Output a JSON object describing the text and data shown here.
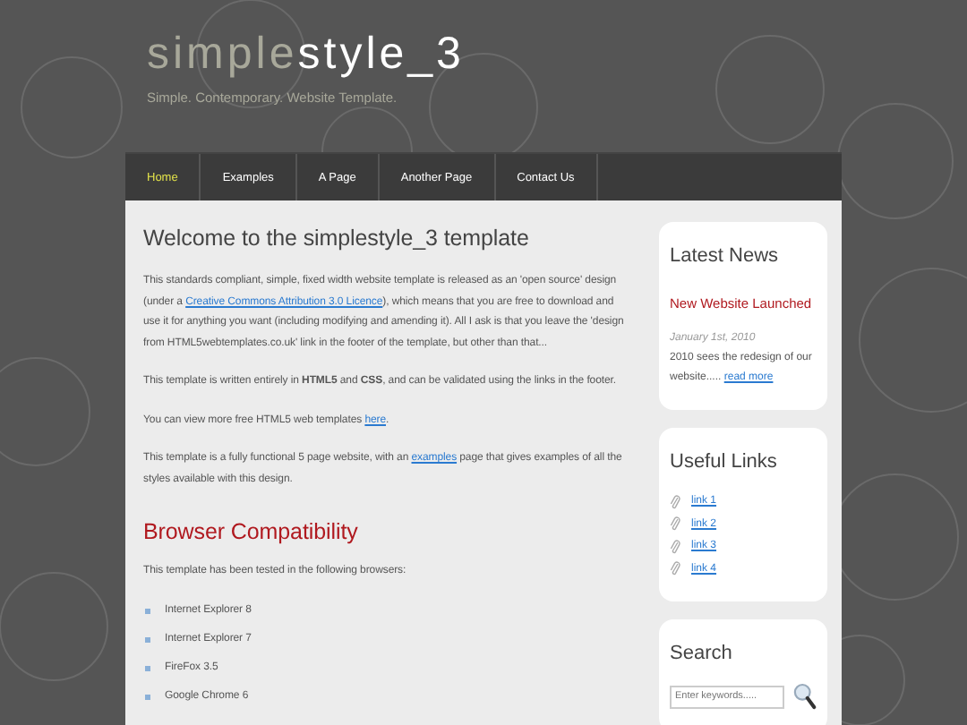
{
  "logo": {
    "light": "simple",
    "bold": "style_3"
  },
  "tagline": "Simple. Contemporary. Website Template.",
  "nav": [
    {
      "label": "Home",
      "selected": true
    },
    {
      "label": "Examples",
      "selected": false
    },
    {
      "label": "A Page",
      "selected": false
    },
    {
      "label": "Another Page",
      "selected": false
    },
    {
      "label": "Contact Us",
      "selected": false
    }
  ],
  "content": [
    {
      "kind": "heading",
      "text": "Welcome to the simplestyle_3 template"
    },
    {
      "kind": "paragraph",
      "parts": [
        {
          "text": "This standards compliant, simple, fixed width website template is released as an 'open source' design (under a "
        },
        {
          "link": "Creative Commons Attribution 3.0 Licence"
        },
        {
          "text": "), which means that you are free to download and use it for anything you want (including modifying and amending it). All I ask is that you leave the 'design from HTML5webtemplates.co.uk' link in the footer of the template, but other than that..."
        }
      ]
    },
    {
      "kind": "paragraph",
      "parts": [
        {
          "text": "This template is written entirely in **HTML5** and **CSS**, and can be validated using the links in the footer."
        }
      ]
    },
    {
      "kind": "paragraph",
      "parts": [
        {
          "text": "You can view more free HTML5 web templates "
        },
        {
          "link": "here"
        },
        {
          "text": "."
        }
      ]
    },
    {
      "kind": "paragraph",
      "parts": [
        {
          "text": "This template is a fully functional 5 page website, with an "
        },
        {
          "link": "examples"
        },
        {
          "text": " page that gives examples of all the styles available with this design."
        }
      ]
    },
    {
      "kind": "subheading",
      "text": "Browser Compatibility"
    },
    {
      "kind": "paragraph",
      "parts": [
        {
          "text": "This template has been tested in the following browsers:"
        }
      ]
    },
    {
      "kind": "list",
      "items": [
        "Internet Explorer 8",
        "Internet Explorer 7",
        "FireFox 3.5",
        "Google Chrome 6"
      ]
    }
  ],
  "sidebar": [
    {
      "kind": "news",
      "title": "Latest News",
      "headline": "New Website Launched",
      "date": "January 1st, 2010",
      "body": "2010 sees the redesign of our website.....",
      "link": "read more"
    },
    {
      "kind": "links",
      "title": "Useful Links",
      "links": [
        "link 1",
        "link 2",
        "link 3",
        "link 4"
      ]
    },
    {
      "kind": "search",
      "title": "Search",
      "placeholder": "Enter keywords....."
    }
  ]
}
